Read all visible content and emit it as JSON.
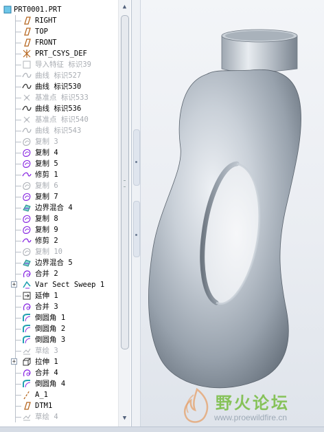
{
  "model_tree": {
    "root_label": "PRT0001.PRT",
    "items": [
      {
        "label": "RIGHT",
        "icon": "datum-plane-icon",
        "dim": false,
        "expandable": false
      },
      {
        "label": "TOP",
        "icon": "datum-plane-icon",
        "dim": false,
        "expandable": false
      },
      {
        "label": "FRONT",
        "icon": "datum-plane-icon",
        "dim": false,
        "expandable": false
      },
      {
        "label": "PRT_CSYS_DEF",
        "icon": "coordinate-system-icon",
        "dim": false,
        "expandable": false
      },
      {
        "label": "导入特征 标识39",
        "icon": "import-feature-icon",
        "dim": true,
        "expandable": false
      },
      {
        "label": "曲线 标识527",
        "icon": "curve-icon",
        "dim": true,
        "expandable": false
      },
      {
        "label": "曲线 标识530",
        "icon": "curve-icon",
        "dim": false,
        "expandable": false
      },
      {
        "label": "基准点 标识533",
        "icon": "datum-point-icon",
        "dim": true,
        "expandable": false
      },
      {
        "label": "曲线 标识536",
        "icon": "curve-icon",
        "dim": false,
        "expandable": false
      },
      {
        "label": "基准点 标识540",
        "icon": "datum-point-icon",
        "dim": true,
        "expandable": false
      },
      {
        "label": "曲线 标识543",
        "icon": "curve-icon",
        "dim": true,
        "expandable": false
      },
      {
        "label": "复制 3",
        "icon": "copy-icon",
        "dim": true,
        "expandable": false
      },
      {
        "label": "复制 4",
        "icon": "copy-icon",
        "dim": false,
        "expandable": false
      },
      {
        "label": "复制 5",
        "icon": "copy-icon",
        "dim": false,
        "expandable": false
      },
      {
        "label": "修剪 1",
        "icon": "trim-icon",
        "dim": false,
        "expandable": false
      },
      {
        "label": "复制 6",
        "icon": "copy-icon",
        "dim": true,
        "expandable": false
      },
      {
        "label": "复制 7",
        "icon": "copy-icon",
        "dim": false,
        "expandable": false
      },
      {
        "label": "边界混合 4",
        "icon": "boundary-blend-icon",
        "dim": false,
        "expandable": false
      },
      {
        "label": "复制 8",
        "icon": "copy-icon",
        "dim": false,
        "expandable": false
      },
      {
        "label": "复制 9",
        "icon": "copy-icon",
        "dim": false,
        "expandable": false
      },
      {
        "label": "修剪 2",
        "icon": "trim-icon",
        "dim": false,
        "expandable": false
      },
      {
        "label": "复制 10",
        "icon": "copy-icon",
        "dim": true,
        "expandable": false
      },
      {
        "label": "边界混合 5",
        "icon": "boundary-blend-icon",
        "dim": false,
        "expandable": false
      },
      {
        "label": "合并 2",
        "icon": "merge-icon",
        "dim": false,
        "expandable": false
      },
      {
        "label": "Var Sect Sweep 1",
        "icon": "var-sweep-icon",
        "dim": false,
        "expandable": true
      },
      {
        "label": "延伸 1",
        "icon": "extend-icon",
        "dim": false,
        "expandable": false
      },
      {
        "label": "合并 3",
        "icon": "merge-icon",
        "dim": false,
        "expandable": false
      },
      {
        "label": "倒圆角 1",
        "icon": "round-icon",
        "dim": false,
        "expandable": false
      },
      {
        "label": "倒圆角 2",
        "icon": "round-icon",
        "dim": false,
        "expandable": false
      },
      {
        "label": "倒圆角 3",
        "icon": "round-icon",
        "dim": false,
        "expandable": false
      },
      {
        "label": "草绘 3",
        "icon": "sketch-icon",
        "dim": true,
        "expandable": false
      },
      {
        "label": "拉伸 1",
        "icon": "extrude-icon",
        "dim": false,
        "expandable": true
      },
      {
        "label": "合并 4",
        "icon": "merge-icon",
        "dim": false,
        "expandable": false
      },
      {
        "label": "倒圆角 4",
        "icon": "round-icon",
        "dim": false,
        "expandable": false
      },
      {
        "label": "A_1",
        "icon": "axis-icon",
        "dim": false,
        "expandable": false
      },
      {
        "label": "DTM1",
        "icon": "datum-plane-icon",
        "dim": false,
        "expandable": false
      },
      {
        "label": "草绘 4",
        "icon": "sketch-icon",
        "dim": true,
        "expandable": false
      }
    ]
  },
  "scrollbar": {
    "up_arrow": "▲",
    "down_arrow": "▼"
  },
  "watermark": {
    "title": "野火论坛",
    "url": "www.proewildfire.cn"
  },
  "colors": {
    "model_shade": "#9aa3ad",
    "accent_purple": "#8a2be2",
    "plane_orange": "#c07020",
    "tree_line": "#b9bfc8"
  }
}
